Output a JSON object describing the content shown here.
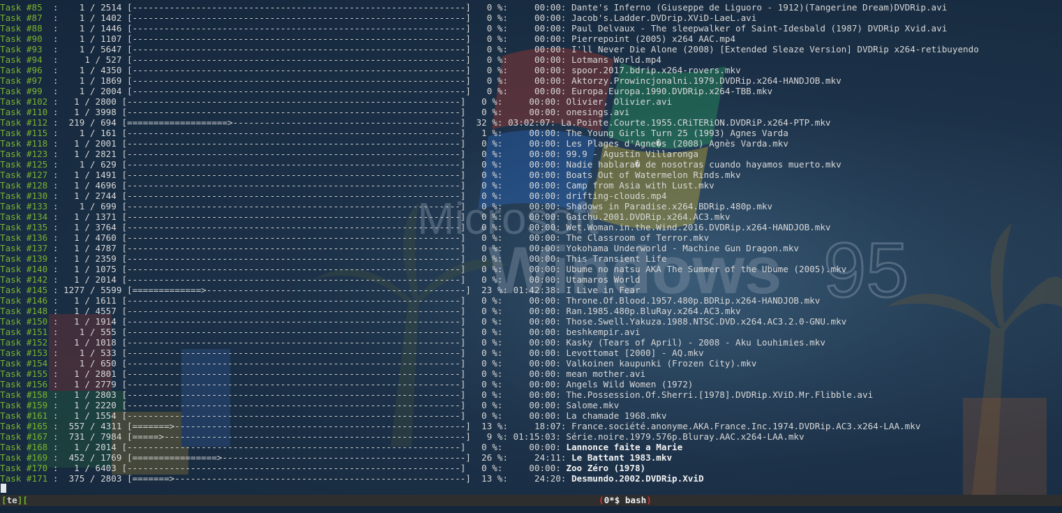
{
  "tasks": [
    {
      "id": "Task #85",
      "progress": "   1 / 2514",
      "bar": "[---------------------------------------------------------------]",
      "pct": "  0 %:",
      "time": "    00:00:",
      "name": "Dante's Inferno (Giuseppe de Liguoro - 1912)(Tangerine Dream)DVDRip.avi",
      "bold": false
    },
    {
      "id": "Task #87",
      "progress": "   1 / 1402",
      "bar": "[---------------------------------------------------------------]",
      "pct": "  0 %:",
      "time": "    00:00:",
      "name": "Jacob's.Ladder.DVDrip.XViD-LaeL.avi",
      "bold": false
    },
    {
      "id": "Task #88",
      "progress": "   1 / 1446",
      "bar": "[---------------------------------------------------------------]",
      "pct": "  0 %:",
      "time": "    00:00:",
      "name": "Paul Delvaux - The sleepwalker of Saint-Idesbald (1987) DVDRip Xvid.avi",
      "bold": false
    },
    {
      "id": "Task #90",
      "progress": "   1 / 1107",
      "bar": "[---------------------------------------------------------------]",
      "pct": "  0 %:",
      "time": "    00:00:",
      "name": "Pierrepoint (2005) x264 AAC.mp4",
      "bold": false
    },
    {
      "id": "Task #93",
      "progress": "   1 / 5647",
      "bar": "[---------------------------------------------------------------]",
      "pct": "  0 %:",
      "time": "    00:00:",
      "name": "I'll Never Die Alone (2008) [Extended Sleaze Version] DVDRip x264-retibuyendo",
      "bold": false
    },
    {
      "id": "Task #94",
      "progress": "    1 / 527",
      "bar": "[---------------------------------------------------------------]",
      "pct": "  0 %:",
      "time": "    00:00:",
      "name": "Lotmans World.mp4",
      "bold": false
    },
    {
      "id": "Task #96",
      "progress": "   1 / 4350",
      "bar": "[---------------------------------------------------------------]",
      "pct": "  0 %:",
      "time": "    00:00:",
      "name": "spoor.2017.bdrip.x264-rovers.mkv",
      "bold": false
    },
    {
      "id": "Task #97",
      "progress": "   1 / 1869",
      "bar": "[---------------------------------------------------------------]",
      "pct": "  0 %:",
      "time": "    00:00:",
      "name": "Aktorzy.Prowincjonalni.1979.DVDRip.x264-HANDJOB.mkv",
      "bold": false
    },
    {
      "id": "Task #99",
      "progress": "   1 / 2004",
      "bar": "[---------------------------------------------------------------]",
      "pct": "  0 %:",
      "time": "    00:00:",
      "name": "Europa.Europa.1990.DVDRip.x264-TBB.mkv",
      "bold": false
    },
    {
      "id": "Task #102",
      "progress": "  1 / 2800",
      "bar": "[---------------------------------------------------------------]",
      "pct": "  0 %:",
      "time": "    00:00:",
      "name": "Olivier, Olivier.avi",
      "bold": false
    },
    {
      "id": "Task #110",
      "progress": "  1 / 3998",
      "bar": "[---------------------------------------------------------------]",
      "pct": "  0 %:",
      "time": "    00:00:",
      "name": "onesings.avi",
      "bold": false
    },
    {
      "id": "Task #112",
      "progress": " 219 / 694",
      "bar": "[===================>-------------------------------------------]",
      "pct": " 32 %:",
      "time": "03:02:07:",
      "name": "La.Pointe.Courte.1955.CRiTERiON.DVDRiP.x264-PTP.mkv",
      "bold": false
    },
    {
      "id": "Task #115",
      "progress": "   1 / 161",
      "bar": "[---------------------------------------------------------------]",
      "pct": "  1 %:",
      "time": "    00:00:",
      "name": "The Young Girls Turn 25 (1993) Agnes Varda",
      "bold": false
    },
    {
      "id": "Task #118",
      "progress": "  1 / 2001",
      "bar": "[---------------------------------------------------------------]",
      "pct": "  0 %:",
      "time": "    00:00:",
      "name": "Les Plages d'Agne�s (2008) Agnès Varda.mkv",
      "bold": false
    },
    {
      "id": "Task #123",
      "progress": "  1 / 2821",
      "bar": "[---------------------------------------------------------------]",
      "pct": "  0 %:",
      "time": "    00:00:",
      "name": "99.9 - Agustín Villaronga",
      "bold": false
    },
    {
      "id": "Task #125",
      "progress": "   1 / 629",
      "bar": "[---------------------------------------------------------------]",
      "pct": "  0 %:",
      "time": "    00:00:",
      "name": "Nadie hablara� de nosotras cuando hayamos muerto.mkv",
      "bold": false
    },
    {
      "id": "Task #127",
      "progress": "  1 / 1491",
      "bar": "[---------------------------------------------------------------]",
      "pct": "  0 %:",
      "time": "    00:00:",
      "name": "Boats Out of Watermelon Rinds.mkv",
      "bold": false
    },
    {
      "id": "Task #128",
      "progress": "  1 / 4696",
      "bar": "[---------------------------------------------------------------]",
      "pct": "  0 %:",
      "time": "    00:00:",
      "name": "Camp from Asia with Lust.mkv",
      "bold": false
    },
    {
      "id": "Task #130",
      "progress": "  1 / 2744",
      "bar": "[---------------------------------------------------------------]",
      "pct": "  0 %:",
      "time": "    00:00:",
      "name": "drifting-clouds.mp4",
      "bold": false
    },
    {
      "id": "Task #133",
      "progress": "   1 / 699",
      "bar": "[---------------------------------------------------------------]",
      "pct": "  0 %:",
      "time": "    00:00:",
      "name": "Shadows in Paradise.x264.BDRip.480p.mkv",
      "bold": false
    },
    {
      "id": "Task #134",
      "progress": "  1 / 1371",
      "bar": "[---------------------------------------------------------------]",
      "pct": "  0 %:",
      "time": "    00:00:",
      "name": "Gaichu.2001.DVDRip.x264.AC3.mkv",
      "bold": false
    },
    {
      "id": "Task #135",
      "progress": "  1 / 3764",
      "bar": "[---------------------------------------------------------------]",
      "pct": "  0 %:",
      "time": "    00:00:",
      "name": "Wet.Woman.in.the.Wind.2016.DVDRip.x264-HANDJOB.mkv",
      "bold": false
    },
    {
      "id": "Task #136",
      "progress": "  1 / 4760",
      "bar": "[---------------------------------------------------------------]",
      "pct": "  0 %:",
      "time": "    00:00:",
      "name": "The Classroom of Terror.mkv",
      "bold": false
    },
    {
      "id": "Task #137",
      "progress": "  1 / 4787",
      "bar": "[---------------------------------------------------------------]",
      "pct": "  0 %:",
      "time": "    00:00:",
      "name": "Yokohama Underworld - Machine Gun Dragon.mkv",
      "bold": false
    },
    {
      "id": "Task #139",
      "progress": "  1 / 2359",
      "bar": "[---------------------------------------------------------------]",
      "pct": "  0 %:",
      "time": "    00:00:",
      "name": "This Transient Life",
      "bold": false
    },
    {
      "id": "Task #140",
      "progress": "  1 / 1075",
      "bar": "[---------------------------------------------------------------]",
      "pct": "  0 %:",
      "time": "    00:00:",
      "name": "Ubume no natsu AKA The Summer of the Ubume (2005).mkv",
      "bold": false
    },
    {
      "id": "Task #142",
      "progress": "  1 / 2014",
      "bar": "[---------------------------------------------------------------]",
      "pct": "  0 %:",
      "time": "    00:00:",
      "name": "Utamaros World",
      "bold": false
    },
    {
      "id": "Task #145",
      "progress": "1277 / 5599",
      "bar": "[=============>-------------------------------------------------]",
      "pct": " 23 %:",
      "time": "01:42:38:",
      "name": "I Live in Fear",
      "bold": false
    },
    {
      "id": "Task #146",
      "progress": "  1 / 1611",
      "bar": "[---------------------------------------------------------------]",
      "pct": "  0 %:",
      "time": "    00:00:",
      "name": "Throne.Of.Blood.1957.480p.BDRip.x264-HANDJOB.mkv",
      "bold": false
    },
    {
      "id": "Task #148",
      "progress": "  1 / 4557",
      "bar": "[---------------------------------------------------------------]",
      "pct": "  0 %:",
      "time": "    00:00:",
      "name": "Ran.1985.480p.BluRay.x264.AC3.mkv",
      "bold": false
    },
    {
      "id": "Task #150",
      "progress": "  1 / 1914",
      "bar": "[---------------------------------------------------------------]",
      "pct": "  0 %:",
      "time": "    00:00:",
      "name": "Those.Swell.Yakuza.1988.NTSC.DVD.x264.AC3.2.0-GNU.mkv",
      "bold": false
    },
    {
      "id": "Task #151",
      "progress": "   1 / 555",
      "bar": "[---------------------------------------------------------------]",
      "pct": "  0 %:",
      "time": "    00:00:",
      "name": "beshkempir.avi",
      "bold": false
    },
    {
      "id": "Task #152",
      "progress": "  1 / 1018",
      "bar": "[---------------------------------------------------------------]",
      "pct": "  0 %:",
      "time": "    00:00:",
      "name": "Kasky (Tears of April) - 2008 - Aku Louhimies.mkv",
      "bold": false
    },
    {
      "id": "Task #153",
      "progress": "   1 / 533",
      "bar": "[---------------------------------------------------------------]",
      "pct": "  0 %:",
      "time": "    00:00:",
      "name": "Levottomat [2000] - AQ.mkv",
      "bold": false
    },
    {
      "id": "Task #154",
      "progress": "   1 / 650",
      "bar": "[---------------------------------------------------------------]",
      "pct": "  0 %:",
      "time": "    00:00:",
      "name": "Valkoinen kaupunki (Frozen City).mkv",
      "bold": false
    },
    {
      "id": "Task #155",
      "progress": "  1 / 2801",
      "bar": "[---------------------------------------------------------------]",
      "pct": "  0 %:",
      "time": "    00:00:",
      "name": "mean mother.avi",
      "bold": false
    },
    {
      "id": "Task #156",
      "progress": "  1 / 2779",
      "bar": "[---------------------------------------------------------------]",
      "pct": "  0 %:",
      "time": "    00:00:",
      "name": "Angels Wild Women (1972)",
      "bold": false
    },
    {
      "id": "Task #158",
      "progress": "  1 / 2803",
      "bar": "[---------------------------------------------------------------]",
      "pct": "  0 %:",
      "time": "    00:00:",
      "name": "The.Possession.Of.Sherri.[1978].DVDRip.XViD.Mr.Flibble.avi",
      "bold": false
    },
    {
      "id": "Task #159",
      "progress": "  1 / 2220",
      "bar": "[---------------------------------------------------------------]",
      "pct": "  0 %:",
      "time": "    00:00:",
      "name": "Salome.mkv",
      "bold": false
    },
    {
      "id": "Task #161",
      "progress": "  1 / 1554",
      "bar": "[---------------------------------------------------------------]",
      "pct": "  0 %:",
      "time": "    00:00:",
      "name": "La chamade 1968.mkv",
      "bold": false
    },
    {
      "id": "Task #165",
      "progress": " 557 / 4311",
      "bar": "[=======>-------------------------------------------------------]",
      "pct": " 13 %:",
      "time": "    18:07:",
      "name": "France.société.anonyme.AKA.France.Inc.1974.DVDRip.AC3.x264-LAA.mkv",
      "bold": false
    },
    {
      "id": "Task #167",
      "progress": " 731 / 7984",
      "bar": "[=====>---------------------------------------------------------]",
      "pct": "  9 %:",
      "time": "01:15:03:",
      "name": "Série.noire.1979.576p.Bluray.AAC.x264-LAA.mkv",
      "bold": false
    },
    {
      "id": "Task #168",
      "progress": "  1 / 2014",
      "bar": "[---------------------------------------------------------------]",
      "pct": "  0 %:",
      "time": "    00:00:",
      "name": "Lannonce faite a Marie",
      "bold": true
    },
    {
      "id": "Task #169",
      "progress": " 452 / 1769",
      "bar": "[================>----------------------------------------------]",
      "pct": " 26 %:",
      "time": "    24:11:",
      "name": "Le Battant 1983.mkv",
      "bold": true
    },
    {
      "id": "Task #170",
      "progress": "  1 / 6403",
      "bar": "[---------------------------------------------------------------]",
      "pct": "  0 %:",
      "time": "    00:00:",
      "name": "Zoo Zéro (1978)",
      "bold": true
    },
    {
      "id": "Task #171",
      "progress": " 375 / 2803",
      "bar": "[=======>-------------------------------------------------------]",
      "pct": " 13 %:",
      "time": "    24:20:",
      "name": "Desmundo.2002.DVDRip.XviD",
      "bold": true
    }
  ],
  "statusbar": {
    "session_open": "[",
    "session": "te",
    "session_close": "][",
    "window_open": "(",
    "window": "0*$ bash",
    "window_close": ")"
  },
  "wallpaper": {
    "brand": "Microsoft",
    "product": "Windows",
    "version": "95"
  }
}
